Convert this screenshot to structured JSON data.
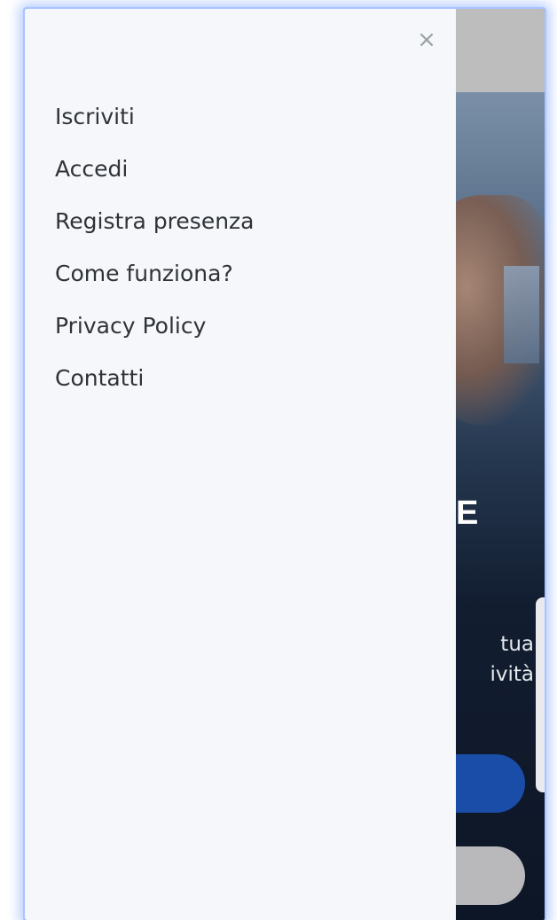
{
  "drawer": {
    "close_icon": "×",
    "items": [
      {
        "label": "Iscriviti"
      },
      {
        "label": "Accedi"
      },
      {
        "label": "Registra presenza"
      },
      {
        "label": "Come funziona?"
      },
      {
        "label": "Privacy Policy"
      },
      {
        "label": "Contatti"
      }
    ]
  },
  "background": {
    "hero_heading_partial": "E",
    "hero_text_line1_partial": "tua",
    "hero_text_line2_partial": "ività"
  },
  "colors": {
    "drawer_bg": "#f5f7fa",
    "header_bg": "#bdbdbd",
    "primary_button": "#1a4da8",
    "secondary_button": "#b9b9bb",
    "hero_dark": "#0d1626"
  }
}
